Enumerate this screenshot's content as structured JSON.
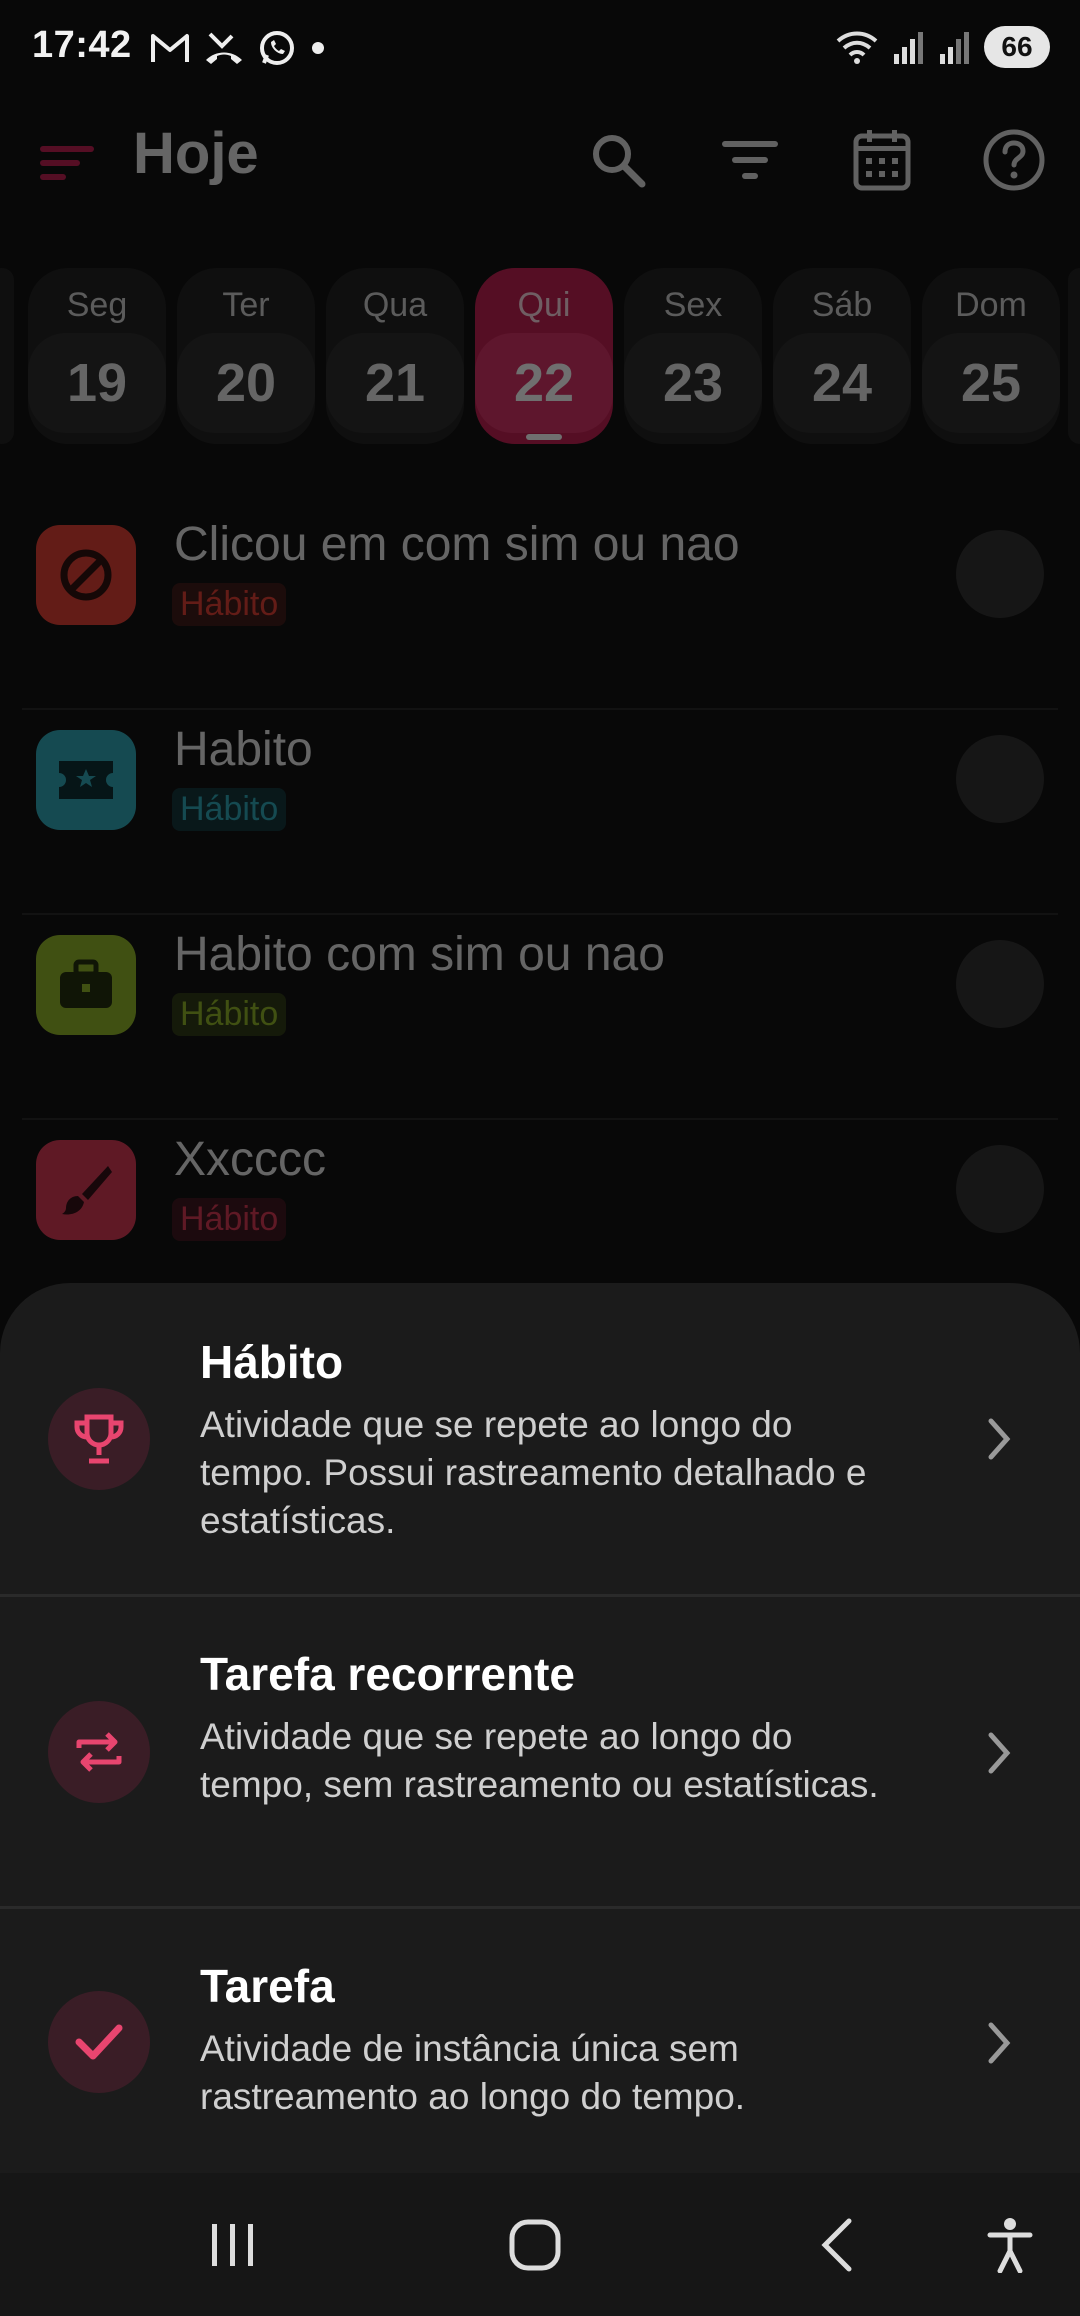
{
  "status_bar": {
    "time": "17:42",
    "left_icons": [
      "gmail-icon",
      "missed-call-icon",
      "whatsapp-icon",
      "dot-icon"
    ],
    "right_icons": [
      "wifi-icon",
      "signal-icon",
      "signal-icon"
    ],
    "battery": "66"
  },
  "appbar": {
    "title": "Hoje",
    "actions": [
      "search-icon",
      "filter-icon",
      "calendar-icon",
      "help-icon"
    ],
    "accent": "#c2194e"
  },
  "week": {
    "days": [
      {
        "name": "Seg",
        "num": "19"
      },
      {
        "name": "Ter",
        "num": "20"
      },
      {
        "name": "Qua",
        "num": "21"
      },
      {
        "name": "Qui",
        "num": "22"
      },
      {
        "name": "Sex",
        "num": "23"
      },
      {
        "name": "Sáb",
        "num": "24"
      },
      {
        "name": "Dom",
        "num": "25"
      }
    ],
    "selected": "Qui"
  },
  "habits": [
    {
      "title": "Clicou em com sim ou nao",
      "tag": "Hábito",
      "icon": "block-icon",
      "color": "#e23a2e"
    },
    {
      "title": "Habito",
      "tag": "Hábito",
      "icon": "ticket-icon",
      "color": "#2aa8b8"
    },
    {
      "title": "Habito com sim ou nao",
      "tag": "Hábito",
      "icon": "briefcase-icon",
      "color": "#8fb523"
    },
    {
      "title": "Xxcccc",
      "tag": "Hábito",
      "icon": "brush-icon",
      "color": "#d93350"
    }
  ],
  "sheet": {
    "options": [
      {
        "title": "Hábito",
        "description": "Atividade que se repete ao longo do tempo. Possui rastreamento detalhado e estatísticas.",
        "icon": "trophy-icon"
      },
      {
        "title": "Tarefa recorrente",
        "description": "Atividade que se repete ao longo do tempo, sem rastreamento ou estatísticas.",
        "icon": "repeat-icon"
      },
      {
        "title": "Tarefa",
        "description": "Atividade de instância única sem rastreamento ao longo do tempo.",
        "icon": "check-icon"
      }
    ],
    "icon_color": "#e8456f"
  },
  "navbar": {
    "buttons": [
      "recents-icon",
      "home-icon",
      "back-icon",
      "accessibility-icon"
    ]
  }
}
